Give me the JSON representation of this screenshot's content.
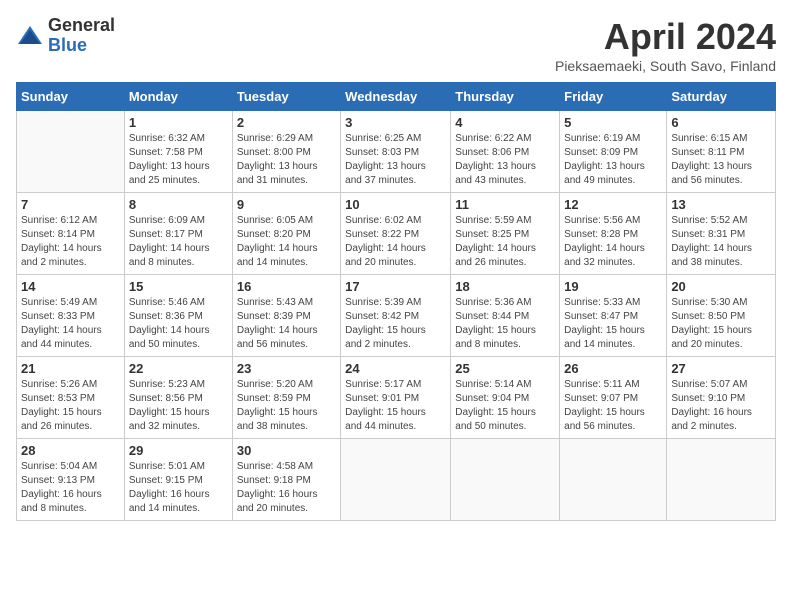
{
  "header": {
    "logo_general": "General",
    "logo_blue": "Blue",
    "month_year": "April 2024",
    "location": "Pieksaemaeki, South Savo, Finland"
  },
  "calendar": {
    "days_of_week": [
      "Sunday",
      "Monday",
      "Tuesday",
      "Wednesday",
      "Thursday",
      "Friday",
      "Saturday"
    ],
    "weeks": [
      [
        {
          "day": "",
          "info": ""
        },
        {
          "day": "1",
          "info": "Sunrise: 6:32 AM\nSunset: 7:58 PM\nDaylight: 13 hours\nand 25 minutes."
        },
        {
          "day": "2",
          "info": "Sunrise: 6:29 AM\nSunset: 8:00 PM\nDaylight: 13 hours\nand 31 minutes."
        },
        {
          "day": "3",
          "info": "Sunrise: 6:25 AM\nSunset: 8:03 PM\nDaylight: 13 hours\nand 37 minutes."
        },
        {
          "day": "4",
          "info": "Sunrise: 6:22 AM\nSunset: 8:06 PM\nDaylight: 13 hours\nand 43 minutes."
        },
        {
          "day": "5",
          "info": "Sunrise: 6:19 AM\nSunset: 8:09 PM\nDaylight: 13 hours\nand 49 minutes."
        },
        {
          "day": "6",
          "info": "Sunrise: 6:15 AM\nSunset: 8:11 PM\nDaylight: 13 hours\nand 56 minutes."
        }
      ],
      [
        {
          "day": "7",
          "info": "Sunrise: 6:12 AM\nSunset: 8:14 PM\nDaylight: 14 hours\nand 2 minutes."
        },
        {
          "day": "8",
          "info": "Sunrise: 6:09 AM\nSunset: 8:17 PM\nDaylight: 14 hours\nand 8 minutes."
        },
        {
          "day": "9",
          "info": "Sunrise: 6:05 AM\nSunset: 8:20 PM\nDaylight: 14 hours\nand 14 minutes."
        },
        {
          "day": "10",
          "info": "Sunrise: 6:02 AM\nSunset: 8:22 PM\nDaylight: 14 hours\nand 20 minutes."
        },
        {
          "day": "11",
          "info": "Sunrise: 5:59 AM\nSunset: 8:25 PM\nDaylight: 14 hours\nand 26 minutes."
        },
        {
          "day": "12",
          "info": "Sunrise: 5:56 AM\nSunset: 8:28 PM\nDaylight: 14 hours\nand 32 minutes."
        },
        {
          "day": "13",
          "info": "Sunrise: 5:52 AM\nSunset: 8:31 PM\nDaylight: 14 hours\nand 38 minutes."
        }
      ],
      [
        {
          "day": "14",
          "info": "Sunrise: 5:49 AM\nSunset: 8:33 PM\nDaylight: 14 hours\nand 44 minutes."
        },
        {
          "day": "15",
          "info": "Sunrise: 5:46 AM\nSunset: 8:36 PM\nDaylight: 14 hours\nand 50 minutes."
        },
        {
          "day": "16",
          "info": "Sunrise: 5:43 AM\nSunset: 8:39 PM\nDaylight: 14 hours\nand 56 minutes."
        },
        {
          "day": "17",
          "info": "Sunrise: 5:39 AM\nSunset: 8:42 PM\nDaylight: 15 hours\nand 2 minutes."
        },
        {
          "day": "18",
          "info": "Sunrise: 5:36 AM\nSunset: 8:44 PM\nDaylight: 15 hours\nand 8 minutes."
        },
        {
          "day": "19",
          "info": "Sunrise: 5:33 AM\nSunset: 8:47 PM\nDaylight: 15 hours\nand 14 minutes."
        },
        {
          "day": "20",
          "info": "Sunrise: 5:30 AM\nSunset: 8:50 PM\nDaylight: 15 hours\nand 20 minutes."
        }
      ],
      [
        {
          "day": "21",
          "info": "Sunrise: 5:26 AM\nSunset: 8:53 PM\nDaylight: 15 hours\nand 26 minutes."
        },
        {
          "day": "22",
          "info": "Sunrise: 5:23 AM\nSunset: 8:56 PM\nDaylight: 15 hours\nand 32 minutes."
        },
        {
          "day": "23",
          "info": "Sunrise: 5:20 AM\nSunset: 8:59 PM\nDaylight: 15 hours\nand 38 minutes."
        },
        {
          "day": "24",
          "info": "Sunrise: 5:17 AM\nSunset: 9:01 PM\nDaylight: 15 hours\nand 44 minutes."
        },
        {
          "day": "25",
          "info": "Sunrise: 5:14 AM\nSunset: 9:04 PM\nDaylight: 15 hours\nand 50 minutes."
        },
        {
          "day": "26",
          "info": "Sunrise: 5:11 AM\nSunset: 9:07 PM\nDaylight: 15 hours\nand 56 minutes."
        },
        {
          "day": "27",
          "info": "Sunrise: 5:07 AM\nSunset: 9:10 PM\nDaylight: 16 hours\nand 2 minutes."
        }
      ],
      [
        {
          "day": "28",
          "info": "Sunrise: 5:04 AM\nSunset: 9:13 PM\nDaylight: 16 hours\nand 8 minutes."
        },
        {
          "day": "29",
          "info": "Sunrise: 5:01 AM\nSunset: 9:15 PM\nDaylight: 16 hours\nand 14 minutes."
        },
        {
          "day": "30",
          "info": "Sunrise: 4:58 AM\nSunset: 9:18 PM\nDaylight: 16 hours\nand 20 minutes."
        },
        {
          "day": "",
          "info": ""
        },
        {
          "day": "",
          "info": ""
        },
        {
          "day": "",
          "info": ""
        },
        {
          "day": "",
          "info": ""
        }
      ]
    ]
  }
}
